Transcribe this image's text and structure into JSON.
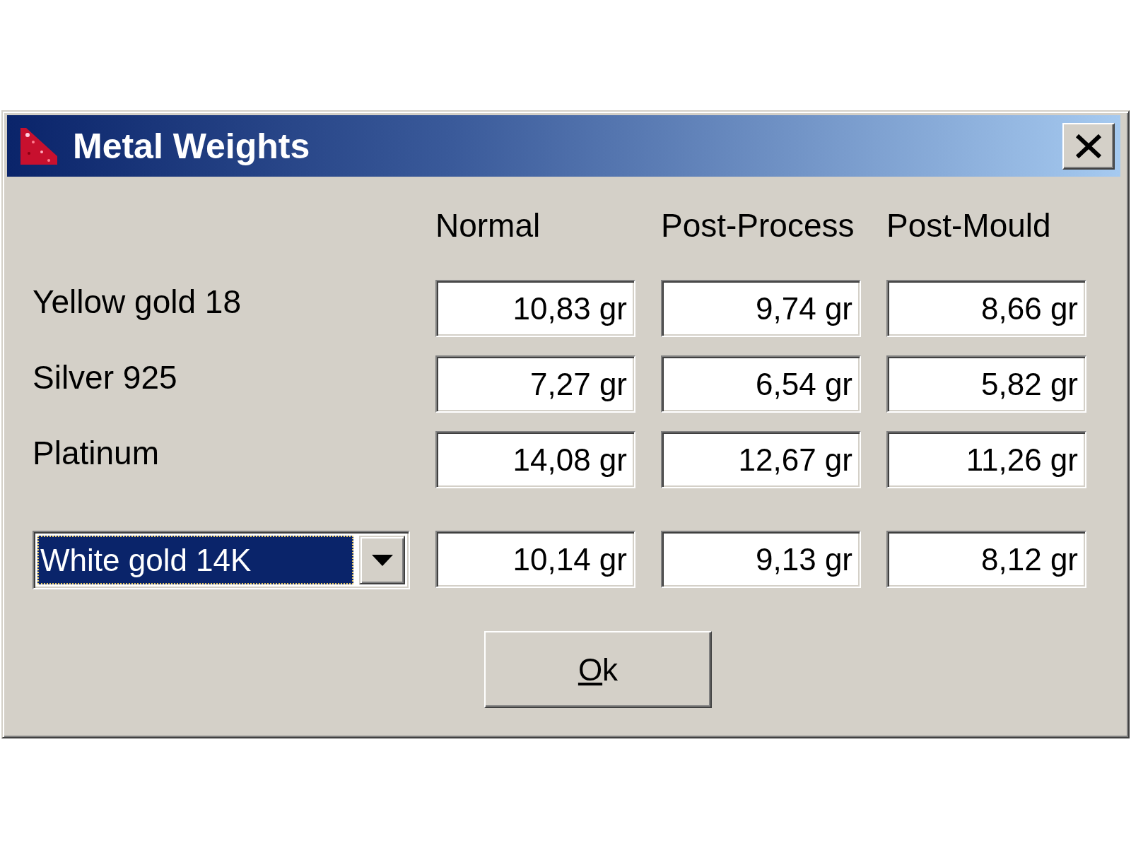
{
  "window": {
    "title": "Metal Weights"
  },
  "columns": [
    "Normal",
    "Post-Process",
    "Post-Mould"
  ],
  "rows": [
    {
      "kind": "label",
      "label": "Yellow gold 18",
      "values": [
        "10,83 gr",
        "9,74 gr",
        "8,66 gr"
      ]
    },
    {
      "kind": "label",
      "label": "Silver 925",
      "values": [
        "7,27 gr",
        "6,54 gr",
        "5,82 gr"
      ]
    },
    {
      "kind": "label",
      "label": "Platinum",
      "values": [
        "14,08 gr",
        "12,67 gr",
        "11,26 gr"
      ]
    },
    {
      "kind": "dropdown",
      "label": "White gold 14K",
      "focused": true,
      "values": [
        "10,14 gr",
        "9,13 gr",
        "8,12 gr"
      ]
    }
  ],
  "buttons": [
    {
      "label": "Ok",
      "first_letter_underlined": true
    }
  ]
}
